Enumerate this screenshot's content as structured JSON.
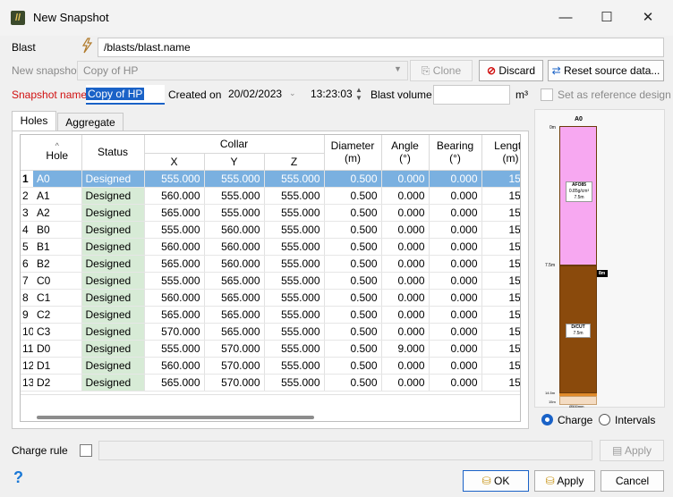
{
  "window": {
    "title": "New Snapshot",
    "minimize": "—",
    "maximize": "☐",
    "close": "✕"
  },
  "blast": {
    "label": "Blast",
    "path": "/blasts/blast.name"
  },
  "new_snapshot": {
    "label": "New snapshot",
    "value": "Copy of HP",
    "clone_label": "Clone",
    "discard_label": "Discard",
    "reset_label": "Reset source data..."
  },
  "snapshot_name": {
    "label": "Snapshot name",
    "value": "Copy of HP"
  },
  "created_on": {
    "label": "Created on",
    "date": "20/02/2023",
    "time": "13:23:03"
  },
  "blast_volume": {
    "label": "Blast volume",
    "value": "",
    "unit": "m³"
  },
  "reference": {
    "label": "Set as reference design"
  },
  "tabs": [
    {
      "label": "Holes"
    },
    {
      "label": "Aggregate"
    }
  ],
  "table": {
    "headers": {
      "hole": "Hole",
      "status": "Status",
      "collar": "Collar",
      "x": "X",
      "y": "Y",
      "z": "Z",
      "diameter": "Diameter",
      "diameter_unit": "(m)",
      "angle": "Angle",
      "angle_unit": "(°)",
      "bearing": "Bearing",
      "bearing_unit": "(°)",
      "length": "Length",
      "length_unit": "(m)"
    },
    "rows": [
      {
        "n": "1",
        "hole": "A0",
        "status": "Designed",
        "x": "555.000",
        "y": "555.000",
        "z": "555.000",
        "d": "0.500",
        "a": "0.000",
        "b": "0.000",
        "l": "15.00"
      },
      {
        "n": "2",
        "hole": "A1",
        "status": "Designed",
        "x": "560.000",
        "y": "555.000",
        "z": "555.000",
        "d": "0.500",
        "a": "0.000",
        "b": "0.000",
        "l": "15.00"
      },
      {
        "n": "3",
        "hole": "A2",
        "status": "Designed",
        "x": "565.000",
        "y": "555.000",
        "z": "555.000",
        "d": "0.500",
        "a": "0.000",
        "b": "0.000",
        "l": "15.00"
      },
      {
        "n": "4",
        "hole": "B0",
        "status": "Designed",
        "x": "555.000",
        "y": "560.000",
        "z": "555.000",
        "d": "0.500",
        "a": "0.000",
        "b": "0.000",
        "l": "15.00"
      },
      {
        "n": "5",
        "hole": "B1",
        "status": "Designed",
        "x": "560.000",
        "y": "560.000",
        "z": "555.000",
        "d": "0.500",
        "a": "0.000",
        "b": "0.000",
        "l": "15.00"
      },
      {
        "n": "6",
        "hole": "B2",
        "status": "Designed",
        "x": "565.000",
        "y": "560.000",
        "z": "555.000",
        "d": "0.500",
        "a": "0.000",
        "b": "0.000",
        "l": "15.00"
      },
      {
        "n": "7",
        "hole": "C0",
        "status": "Designed",
        "x": "555.000",
        "y": "565.000",
        "z": "555.000",
        "d": "0.500",
        "a": "0.000",
        "b": "0.000",
        "l": "15.00"
      },
      {
        "n": "8",
        "hole": "C1",
        "status": "Designed",
        "x": "560.000",
        "y": "565.000",
        "z": "555.000",
        "d": "0.500",
        "a": "0.000",
        "b": "0.000",
        "l": "15.00"
      },
      {
        "n": "9",
        "hole": "C2",
        "status": "Designed",
        "x": "565.000",
        "y": "565.000",
        "z": "555.000",
        "d": "0.500",
        "a": "0.000",
        "b": "0.000",
        "l": "15.00"
      },
      {
        "n": "10",
        "hole": "C3",
        "status": "Designed",
        "x": "570.000",
        "y": "565.000",
        "z": "555.000",
        "d": "0.500",
        "a": "0.000",
        "b": "0.000",
        "l": "15.00"
      },
      {
        "n": "11",
        "hole": "D0",
        "status": "Designed",
        "x": "555.000",
        "y": "570.000",
        "z": "555.000",
        "d": "0.500",
        "a": "9.000",
        "b": "0.000",
        "l": "15.00"
      },
      {
        "n": "12",
        "hole": "D1",
        "status": "Designed",
        "x": "560.000",
        "y": "570.000",
        "z": "555.000",
        "d": "0.500",
        "a": "0.000",
        "b": "0.000",
        "l": "15.00"
      },
      {
        "n": "13",
        "hole": "D2",
        "status": "Designed",
        "x": "565.000",
        "y": "570.000",
        "z": "555.000",
        "d": "0.500",
        "a": "0.000",
        "b": "0.000",
        "l": "15.00"
      }
    ]
  },
  "hole_design": {
    "hole_name": "A0",
    "top_depth": "0m",
    "upper_deck": {
      "name": "AFO85",
      "density": "0.85g/cm³",
      "length": "7.5m"
    },
    "mid_depth": "7.5m",
    "marker": "8m",
    "lower_deck": {
      "name": "D/CUT",
      "length": "7.5m"
    },
    "bottom_depth": "14.5m",
    "total_depth": "15m",
    "diameter": "Ø500mm",
    "colors": {
      "upper": "#f7a8f1",
      "lower": "#8a4a0c",
      "stemming": "#e08a2a"
    }
  },
  "view_mode": {
    "charge_label": "Charge",
    "intervals_label": "Intervals",
    "selected": "charge"
  },
  "charge_rule": {
    "label": "Charge rule",
    "value": "",
    "apply_label": "Apply"
  },
  "footer": {
    "help": "?",
    "ok_label": "OK",
    "apply_label": "Apply",
    "cancel_label": "Cancel"
  },
  "colors": {
    "selection": "#7ab0e0",
    "status_bg": "#d7ebd6",
    "accent": "#1a62c7",
    "required_label": "#d01010"
  }
}
